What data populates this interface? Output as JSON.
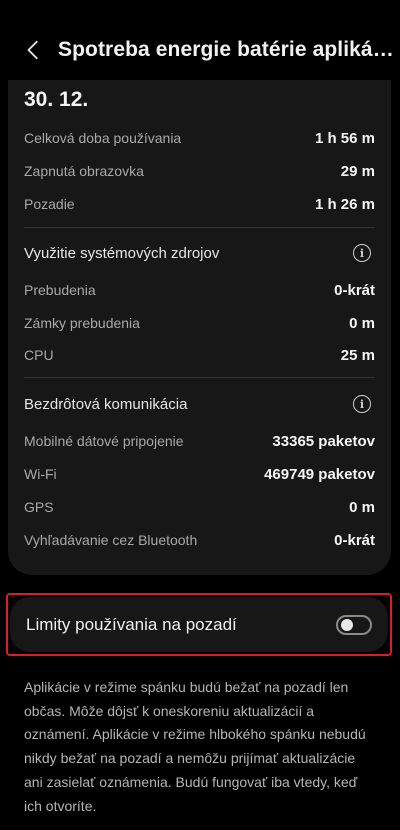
{
  "header": {
    "title": "Spotreba energie batérie aplikácie"
  },
  "date": "30. 12.",
  "usage": [
    {
      "label": "Celková doba používania",
      "value": "1 h 56 m"
    },
    {
      "label": "Zapnutá obrazovka",
      "value": "29 m"
    },
    {
      "label": "Pozadie",
      "value": "1 h 26 m"
    }
  ],
  "system_resources": {
    "title": "Využitie systémových zdrojov",
    "items": [
      {
        "label": "Prebudenia",
        "value": "0-krát"
      },
      {
        "label": "Zámky prebudenia",
        "value": "0 m"
      },
      {
        "label": "CPU",
        "value": "25 m"
      }
    ]
  },
  "wireless": {
    "title": "Bezdrôtová komunikácia",
    "items": [
      {
        "label": "Mobilné dátové pripojenie",
        "value": "33365 paketov"
      },
      {
        "label": "Wi-Fi",
        "value": "469749 paketov"
      },
      {
        "label": "GPS",
        "value": "0 m"
      },
      {
        "label": "Vyhľadávanie cez Bluetooth",
        "value": "0-krát"
      }
    ]
  },
  "background_limits": {
    "label": "Limity používania na pozadí",
    "enabled": false
  },
  "description": "Aplikácie v režime spánku budú bežať na pozadí len občas. Môže dôjsť k oneskoreniu aktualizácií a oznámení. Aplikácie v režime hlbokého spánku nebudú nikdy bežať na pozadí a nemôžu prijímať aktualizácie ani zasielať oznámenia. Budú fungovať iba vtedy, keď ich otvoríte."
}
